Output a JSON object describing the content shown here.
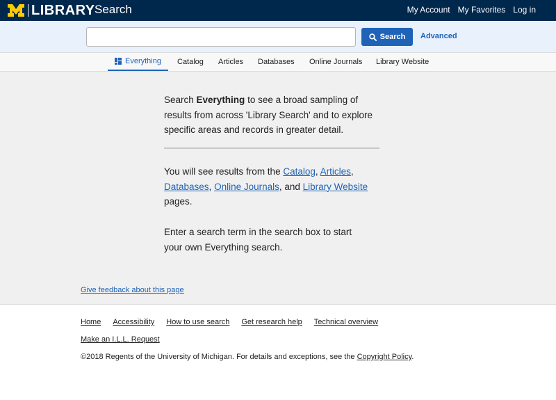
{
  "header": {
    "logo_text": "LIBRARY",
    "logo_mark": "M",
    "app_title": "Search",
    "links": [
      "My Account",
      "My Favorites",
      "Log in"
    ]
  },
  "search": {
    "value": "",
    "placeholder": "",
    "button_label": "Search",
    "button_icon": "search-icon",
    "advanced_label": "Advanced"
  },
  "tabs": [
    {
      "label": "Everything",
      "icon": "grid-icon",
      "active": true
    },
    {
      "label": "Catalog"
    },
    {
      "label": "Articles"
    },
    {
      "label": "Databases"
    },
    {
      "label": "Online Journals"
    },
    {
      "label": "Library Website"
    }
  ],
  "main": {
    "intro_prefix": "Search ",
    "intro_bold": "Everything",
    "intro_suffix": " to see a broad sampling of results from across 'Library Search' and to explore specific areas and records in greater detail.",
    "results_prefix": "You will see results from the ",
    "results_links": [
      "Catalog",
      "Articles",
      "Databases",
      "Online Journals",
      "Library Website"
    ],
    "results_sep1": ", ",
    "results_sep2": ", ",
    "results_sep3": ", ",
    "results_sep4": ", and ",
    "results_suffix": " pages.",
    "enter_text": "Enter a search term in the search box to start your own Everything search.",
    "feedback_link": "Give feedback about this page"
  },
  "footer": {
    "links": [
      "Home",
      "Accessibility",
      "How to use search",
      "Get research help",
      "Technical overview"
    ],
    "ill_link": "Make an I.L.L. Request",
    "copyright_prefix": "©2018 Regents of the University of Michigan. For details and exceptions, see the ",
    "copyright_link": "Copyright Policy",
    "copyright_suffix": "."
  },
  "colors": {
    "header_bg": "#00274c",
    "maize": "#ffcb05",
    "accent": "#1e63b8",
    "search_row_bg": "#e8f1fc",
    "main_bg": "#f0f0f0"
  }
}
